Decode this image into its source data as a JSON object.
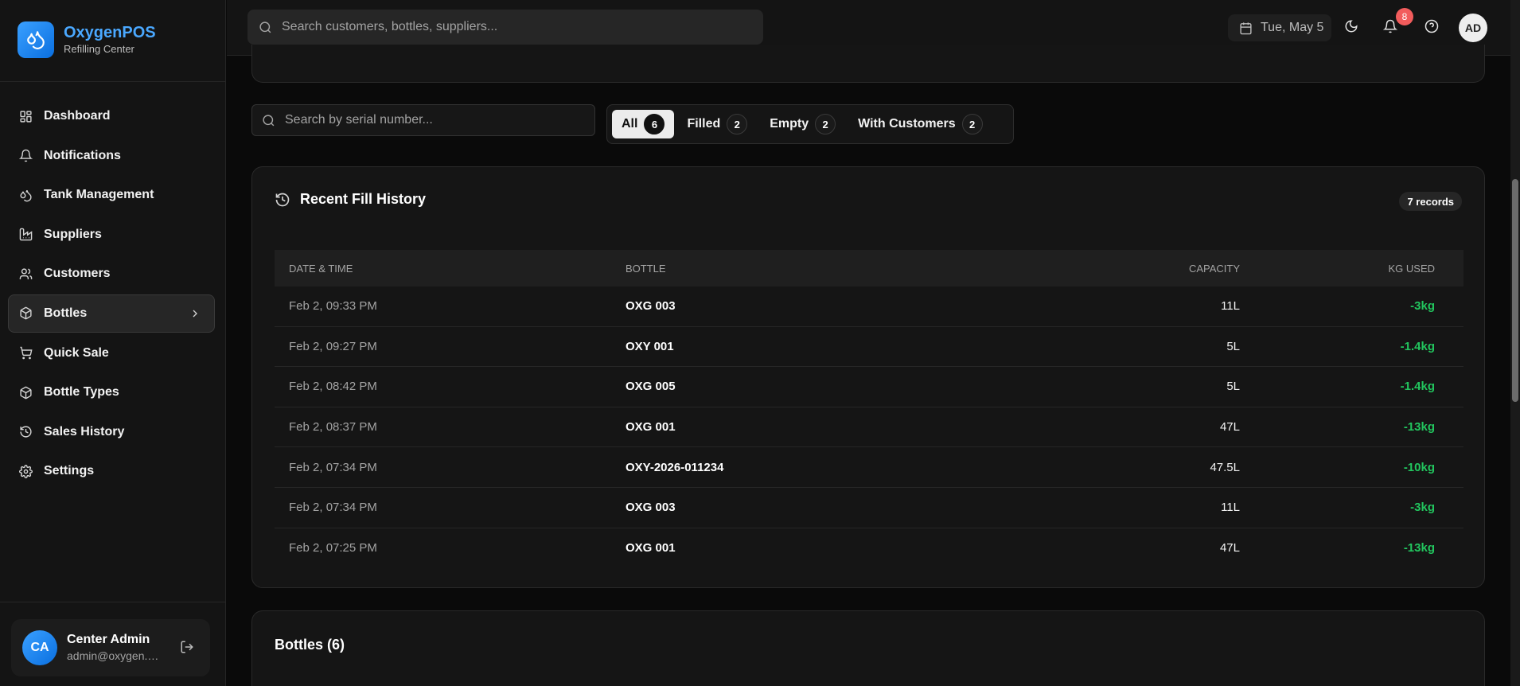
{
  "brand": {
    "name": "OxygenPOS",
    "subtitle": "Refilling Center",
    "accent": "#4aa8ff"
  },
  "sidebar": {
    "items": [
      {
        "label": "Dashboard",
        "icon": "grid-icon"
      },
      {
        "label": "Notifications",
        "icon": "bell-icon"
      },
      {
        "label": "Tank Management",
        "icon": "droplets-icon"
      },
      {
        "label": "Suppliers",
        "icon": "factory-icon"
      },
      {
        "label": "Customers",
        "icon": "users-icon"
      },
      {
        "label": "Bottles",
        "icon": "package-icon",
        "active": true
      },
      {
        "label": "Quick Sale",
        "icon": "cart-icon"
      },
      {
        "label": "Bottle Types",
        "icon": "package-icon"
      },
      {
        "label": "Sales History",
        "icon": "history-icon"
      },
      {
        "label": "Settings",
        "icon": "gear-icon"
      }
    ]
  },
  "user": {
    "initials": "CA",
    "name": "Center Admin",
    "email": "admin@oxygen.c..."
  },
  "topbar": {
    "search_placeholder": "Search customers, bottles, suppliers...",
    "date": "Tue, May 5",
    "notification_count": "8",
    "avatar_initials": "AD"
  },
  "bottles_page": {
    "serial_search_placeholder": "Search by serial number...",
    "filters": [
      {
        "label": "All",
        "count": "6",
        "active": true
      },
      {
        "label": "Filled",
        "count": "2"
      },
      {
        "label": "Empty",
        "count": "2"
      },
      {
        "label": "With Customers",
        "count": "2"
      }
    ]
  },
  "history": {
    "title": "Recent Fill History",
    "records": "7 records",
    "columns": {
      "date": "DATE & TIME",
      "bottle": "BOTTLE",
      "capacity": "CAPACITY",
      "kg": "KG USED"
    },
    "rows": [
      {
        "date": "Feb 2, 09:33 PM",
        "bottle": "OXG 003",
        "capacity": "11L",
        "kg": "-3kg"
      },
      {
        "date": "Feb 2, 09:27 PM",
        "bottle": "OXY 001",
        "capacity": "5L",
        "kg": "-1.4kg"
      },
      {
        "date": "Feb 2, 08:42 PM",
        "bottle": "OXG 005",
        "capacity": "5L",
        "kg": "-1.4kg"
      },
      {
        "date": "Feb 2, 08:37 PM",
        "bottle": "OXG 001",
        "capacity": "47L",
        "kg": "-13kg"
      },
      {
        "date": "Feb 2, 07:34 PM",
        "bottle": "OXY-2026-011234",
        "capacity": "47.5L",
        "kg": "-10kg"
      },
      {
        "date": "Feb 2, 07:34 PM",
        "bottle": "OXG 003",
        "capacity": "11L",
        "kg": "-3kg"
      },
      {
        "date": "Feb 2, 07:25 PM",
        "bottle": "OXG 001",
        "capacity": "47L",
        "kg": "-13kg"
      }
    ]
  },
  "bottles_section": {
    "title": "Bottles (6)"
  },
  "colors": {
    "positive": "#22c55e",
    "badge": "#f25c5c"
  }
}
